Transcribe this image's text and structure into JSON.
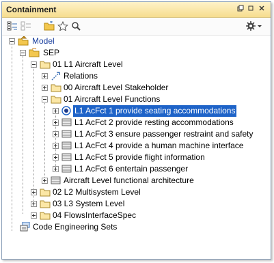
{
  "panel": {
    "title": "Containment"
  },
  "tree": {
    "model": "Model",
    "sep": "SEP",
    "l1": "01 L1 Aircraft Level",
    "relations": "Relations",
    "stakeholder": "00 Aircraft Level Stakeholder",
    "functions": "01 Aircraft Level Functions",
    "fn1": "L1 AcFct 1 provide seating accommodations",
    "fn2": "L1 AcFct 2 provide resting accommodations",
    "fn3": "L1 AcFct 3 ensure passenger restraint and safety",
    "fn4": "L1 AcFct 4 provide a human machine interface",
    "fn5": "L1 AcFct 5 provide flight information",
    "fn6": "L1 AcFct 6 entertain passenger",
    "functional_arch": "Aircraft Level functional architecture",
    "l2": "02 L2 Multisystem Level",
    "l3": "03 L3 System Level",
    "flows": "04 FlowsInterfaceSpec",
    "code_sets": "Code Engineering Sets"
  }
}
